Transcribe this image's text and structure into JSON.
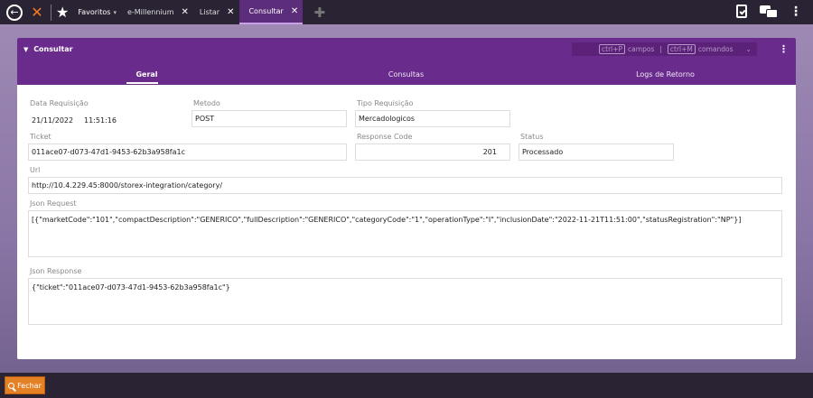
{
  "topbar": {
    "favorites_label": "Favoritos",
    "tabs": [
      {
        "label": "e-Millennium"
      },
      {
        "label": "Listar"
      },
      {
        "label": "Consultar"
      }
    ]
  },
  "panel": {
    "title": "Consultar",
    "shortcut_campos_key": "ctrl+P",
    "shortcut_campos_label": "campos",
    "separator": "|",
    "shortcut_comandos_key": "ctrl+M",
    "shortcut_comandos_label": "comandos",
    "tabs": [
      {
        "label": "Geral"
      },
      {
        "label": "Consultas"
      },
      {
        "label": "Logs de Retorno"
      }
    ]
  },
  "form": {
    "data_requisicao_label": "Data Requisição",
    "data_requisicao_date": "21/11/2022",
    "data_requisicao_time": "11:51:16",
    "metodo_label": "Metodo",
    "metodo_value": "POST",
    "tipo_requisicao_label": "Tipo Requisição",
    "tipo_requisicao_value": "Mercadologicos",
    "ticket_label": "Ticket",
    "ticket_value": "011ace07-d073-47d1-9453-62b3a958fa1c",
    "response_code_label": "Response Code",
    "response_code_value": "201",
    "status_label": "Status",
    "status_value": "Processado",
    "url_label": "Url",
    "url_value": "http://10.4.229.45:8000/storex-integration/category/",
    "json_request_label": "Json Request",
    "json_request_value": "[{\"marketCode\":\"101\",\"compactDescription\":\"GENERICO\",\"fullDescription\":\"GENERICO\",\"categoryCode\":\"1\",\"operationType\":\"I\",\"inclusionDate\":\"2022-11-21T11:51:00\",\"statusRegistration\":\"NP\"}]",
    "json_response_label": "Json Response",
    "json_response_value": "{\"ticket\":\"011ace07-d073-47d1-9453-62b3a958fa1c\"}"
  },
  "footer": {
    "close_label": "Fechar"
  },
  "colors": {
    "header_purple": "#6a2c8c",
    "topbar_dark": "#2a2333",
    "close_orange": "#e58125",
    "logo_orange": "#f47b20"
  }
}
